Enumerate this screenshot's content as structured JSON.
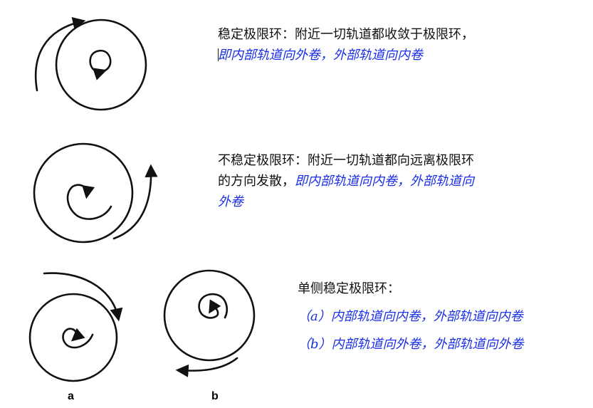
{
  "stable": {
    "text_black": "稳定极限环：附近一切轨道都收敛于极限环，",
    "text_blue": "即内部轨道向外卷，外部轨道向内卷"
  },
  "unstable": {
    "text_black": "不稳定极限环：附近一切轨道都向远离极限环的方向发散，",
    "text_blue": "即内部轨道向内卷，外部轨道向外卷"
  },
  "semi": {
    "title": "单侧稳定极限环：",
    "item_a": "（a）内部轨道向内卷，外部轨道向内卷",
    "item_b": "（b）内部轨道向外卷，外部轨道向外卷"
  },
  "labels": {
    "a": "a",
    "b": "b"
  },
  "colors": {
    "text": "#111111",
    "highlight": "#1a2ee6",
    "stroke": "#111111"
  }
}
